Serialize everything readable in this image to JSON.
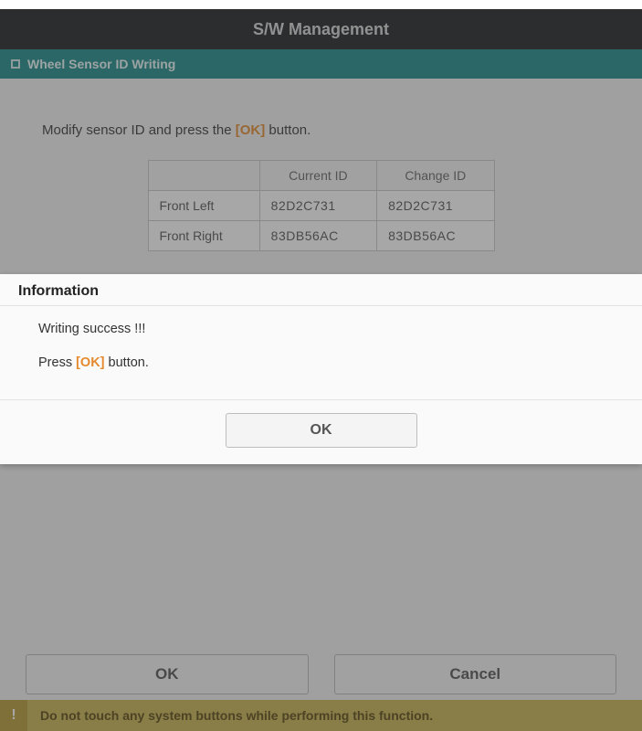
{
  "header": {
    "title": "S/W Management"
  },
  "subheader": {
    "title": "Wheel Sensor ID Writing"
  },
  "instruction": {
    "prefix": "Modify sensor ID and press the ",
    "ok_label": "[OK]",
    "suffix": " button."
  },
  "table": {
    "columns": {
      "blank": "",
      "current": "Current ID",
      "change": "Change ID"
    },
    "rows": [
      {
        "label": "Front Left",
        "current": "82D2C731",
        "change": "82D2C731"
      },
      {
        "label": "Front Right",
        "current": "83DB56AC",
        "change": "83DB56AC"
      }
    ]
  },
  "footer": {
    "ok": "OK",
    "cancel": "Cancel"
  },
  "warning": {
    "icon": "!",
    "text": "Do not touch any system buttons while performing this function."
  },
  "modal": {
    "title": "Information",
    "line1": "Writing success !!!",
    "line2_prefix": "Press ",
    "line2_ok": "[OK]",
    "line2_suffix": " button.",
    "ok": "OK"
  }
}
